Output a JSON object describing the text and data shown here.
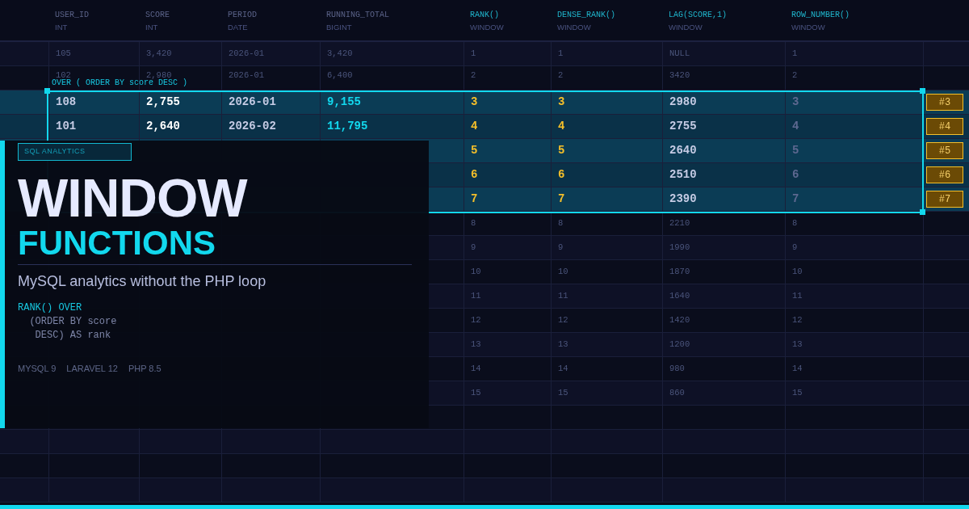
{
  "table": {
    "columns": [
      {
        "name": "USER_ID",
        "type": "INT",
        "kind": "base"
      },
      {
        "name": "SCORE",
        "type": "INT",
        "kind": "base"
      },
      {
        "name": "PERIOD",
        "type": "DATE",
        "kind": "base"
      },
      {
        "name": "RUNNING_TOTAL",
        "type": "BIGINT",
        "kind": "base"
      },
      {
        "name": "RANK()",
        "type": "WINDOW",
        "kind": "window"
      },
      {
        "name": "DENSE_RANK()",
        "type": "WINDOW",
        "kind": "window"
      },
      {
        "name": "LAG(SCORE,1)",
        "type": "WINDOW",
        "kind": "window"
      },
      {
        "name": "ROW_NUMBER()",
        "type": "WINDOW",
        "kind": "window"
      }
    ],
    "rows": [
      {
        "kind": "full",
        "selected": false,
        "cells": [
          "105",
          "3,420",
          "2026-01",
          "3,420",
          "1",
          "1",
          "NULL",
          "1"
        ]
      },
      {
        "kind": "full",
        "selected": false,
        "cells": [
          "102",
          "2,980",
          "2026-01",
          "6,400",
          "2",
          "2",
          "3420",
          "2"
        ]
      },
      {
        "kind": "full",
        "selected": true,
        "cells": [
          "108",
          "2,755",
          "2026-01",
          "9,155",
          "3",
          "3",
          "2980",
          "3"
        ],
        "badge": "#3"
      },
      {
        "kind": "full",
        "selected": true,
        "cells": [
          "101",
          "2,640",
          "2026-02",
          "11,795",
          "4",
          "4",
          "2755",
          "4"
        ],
        "badge": "#4"
      },
      {
        "kind": "covered",
        "selected": true,
        "cells": [
          "5",
          "5",
          "2640",
          "5"
        ],
        "badge": "#5"
      },
      {
        "kind": "covered",
        "selected": true,
        "cells": [
          "6",
          "6",
          "2510",
          "6"
        ],
        "badge": "#6"
      },
      {
        "kind": "covered",
        "selected": true,
        "cells": [
          "7",
          "7",
          "2390",
          "7"
        ],
        "badge": "#7"
      },
      {
        "kind": "covered",
        "selected": false,
        "cells": [
          "8",
          "8",
          "2210",
          "8"
        ]
      },
      {
        "kind": "covered",
        "selected": false,
        "cells": [
          "9",
          "9",
          "1990",
          "9"
        ]
      },
      {
        "kind": "covered",
        "selected": false,
        "cells": [
          "10",
          "10",
          "1870",
          "10"
        ]
      },
      {
        "kind": "covered",
        "selected": false,
        "cells": [
          "11",
          "11",
          "1640",
          "11"
        ]
      },
      {
        "kind": "covered",
        "selected": false,
        "cells": [
          "12",
          "12",
          "1420",
          "12"
        ]
      },
      {
        "kind": "covered",
        "selected": false,
        "cells": [
          "13",
          "13",
          "1200",
          "13"
        ]
      },
      {
        "kind": "covered",
        "selected": false,
        "cells": [
          "14",
          "14",
          "980",
          "14"
        ]
      },
      {
        "kind": "covered",
        "selected": false,
        "cells": [
          "15",
          "15",
          "860",
          "15"
        ]
      }
    ],
    "frame_label": "OVER ( ORDER BY score DESC )"
  },
  "panel": {
    "tag": "SQL ANALYTICS",
    "title": "WINDOW",
    "title_accent": "FUNCTIONS",
    "subtitle": "MySQL analytics without the PHP loop",
    "code": [
      {
        "text": "RANK() OVER",
        "kind": "keyword"
      },
      {
        "text": "  (ORDER BY score",
        "kind": "plain"
      },
      {
        "text": "   DESC) AS rank",
        "kind": "plain"
      }
    ],
    "tech": [
      "MYSQL 9",
      "LARAVEL 12",
      "PHP 8.5"
    ]
  }
}
